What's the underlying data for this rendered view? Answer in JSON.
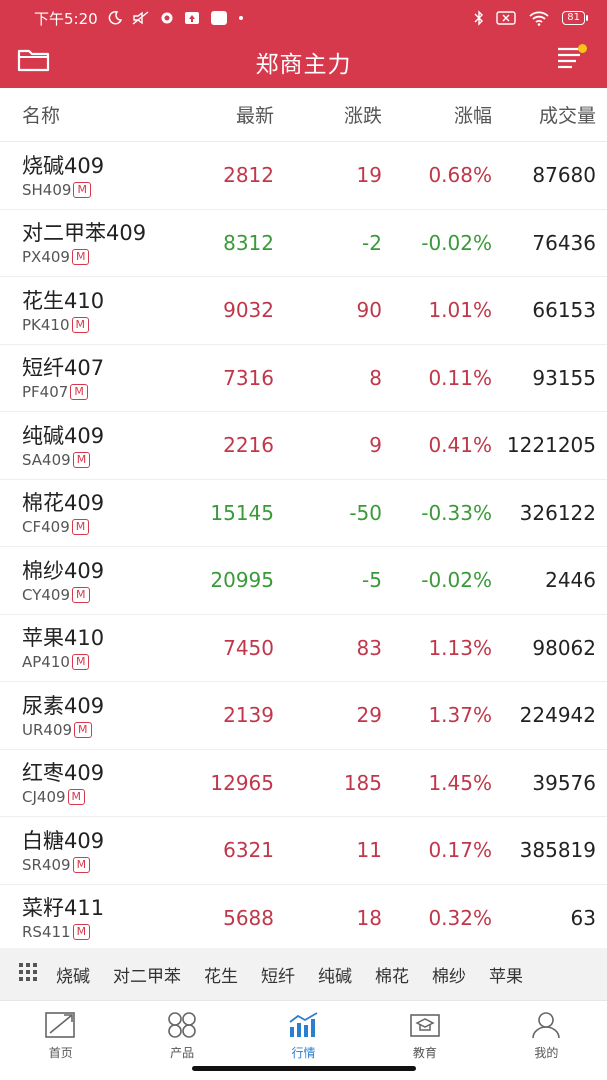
{
  "status_bar": {
    "time": "下午5:20",
    "battery": "81"
  },
  "header": {
    "title": "郑商主力"
  },
  "columns": {
    "name": "名称",
    "last": "最新",
    "change": "涨跌",
    "pct": "涨幅",
    "volume": "成交量"
  },
  "rows": [
    {
      "name": "烧碱409",
      "code": "SH409",
      "badge": "M",
      "last": "2812",
      "change": "19",
      "pct": "0.68%",
      "volume": "87680",
      "dir": "up"
    },
    {
      "name": "对二甲苯409",
      "code": "PX409",
      "badge": "M",
      "last": "8312",
      "change": "-2",
      "pct": "-0.02%",
      "volume": "76436",
      "dir": "down"
    },
    {
      "name": "花生410",
      "code": "PK410",
      "badge": "M",
      "last": "9032",
      "change": "90",
      "pct": "1.01%",
      "volume": "66153",
      "dir": "up"
    },
    {
      "name": "短纤407",
      "code": "PF407",
      "badge": "M",
      "last": "7316",
      "change": "8",
      "pct": "0.11%",
      "volume": "93155",
      "dir": "up"
    },
    {
      "name": "纯碱409",
      "code": "SA409",
      "badge": "M",
      "last": "2216",
      "change": "9",
      "pct": "0.41%",
      "volume": "1221205",
      "dir": "up"
    },
    {
      "name": "棉花409",
      "code": "CF409",
      "badge": "M",
      "last": "15145",
      "change": "-50",
      "pct": "-0.33%",
      "volume": "326122",
      "dir": "down"
    },
    {
      "name": "棉纱409",
      "code": "CY409",
      "badge": "M",
      "last": "20995",
      "change": "-5",
      "pct": "-0.02%",
      "volume": "2446",
      "dir": "down"
    },
    {
      "name": "苹果410",
      "code": "AP410",
      "badge": "M",
      "last": "7450",
      "change": "83",
      "pct": "1.13%",
      "volume": "98062",
      "dir": "up"
    },
    {
      "name": "尿素409",
      "code": "UR409",
      "badge": "M",
      "last": "2139",
      "change": "29",
      "pct": "1.37%",
      "volume": "224942",
      "dir": "up"
    },
    {
      "name": "红枣409",
      "code": "CJ409",
      "badge": "M",
      "last": "12965",
      "change": "185",
      "pct": "1.45%",
      "volume": "39576",
      "dir": "up"
    },
    {
      "name": "白糖409",
      "code": "SR409",
      "badge": "M",
      "last": "6321",
      "change": "11",
      "pct": "0.17%",
      "volume": "385819",
      "dir": "up"
    },
    {
      "name": "菜籽411",
      "code": "RS411",
      "badge": "M",
      "last": "5688",
      "change": "18",
      "pct": "0.32%",
      "volume": "63",
      "dir": "up"
    }
  ],
  "quick_bar": {
    "items": [
      "烧碱",
      "对二甲苯",
      "花生",
      "短纤",
      "纯碱",
      "棉花",
      "棉纱",
      "苹果"
    ]
  },
  "tab_bar": {
    "tabs": [
      {
        "label": "首页",
        "icon": "trend-icon"
      },
      {
        "label": "产品",
        "icon": "product-icon"
      },
      {
        "label": "行情",
        "icon": "market-chart-icon"
      },
      {
        "label": "教育",
        "icon": "education-icon"
      },
      {
        "label": "我的",
        "icon": "profile-icon"
      }
    ],
    "active": "行情"
  },
  "colors": {
    "brand": "#d6394b",
    "up": "#c0374a",
    "down": "#3a9a3a",
    "active_tab": "#2c7fcf",
    "badge_dot": "#f5c518"
  }
}
